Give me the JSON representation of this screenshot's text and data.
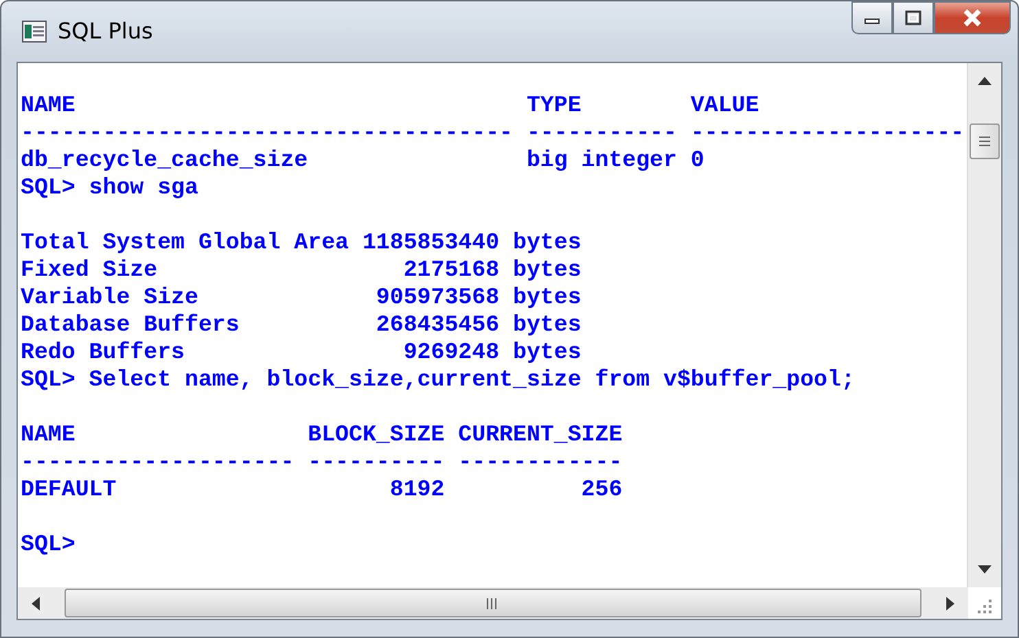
{
  "window": {
    "title": "SQL Plus"
  },
  "console": {
    "blocks": [
      [
        "NAME                                 TYPE        VALUE",
        "------------------------------------ ----------- --------------------",
        "db_recycle_cache_size                big integer 0",
        "SQL> show sga"
      ],
      [
        "Total System Global Area 1185853440 bytes",
        "Fixed Size                  2175168 bytes",
        "Variable Size             905973568 bytes",
        "Database Buffers          268435456 bytes",
        "Redo Buffers                9269248 bytes",
        "SQL> Select name, block_size,current_size from v$buffer_pool;"
      ],
      [
        "NAME                 BLOCK_SIZE CURRENT_SIZE",
        "-------------------- ---------- ------------",
        "DEFAULT                    8192          256"
      ],
      [
        "SQL>"
      ]
    ]
  }
}
